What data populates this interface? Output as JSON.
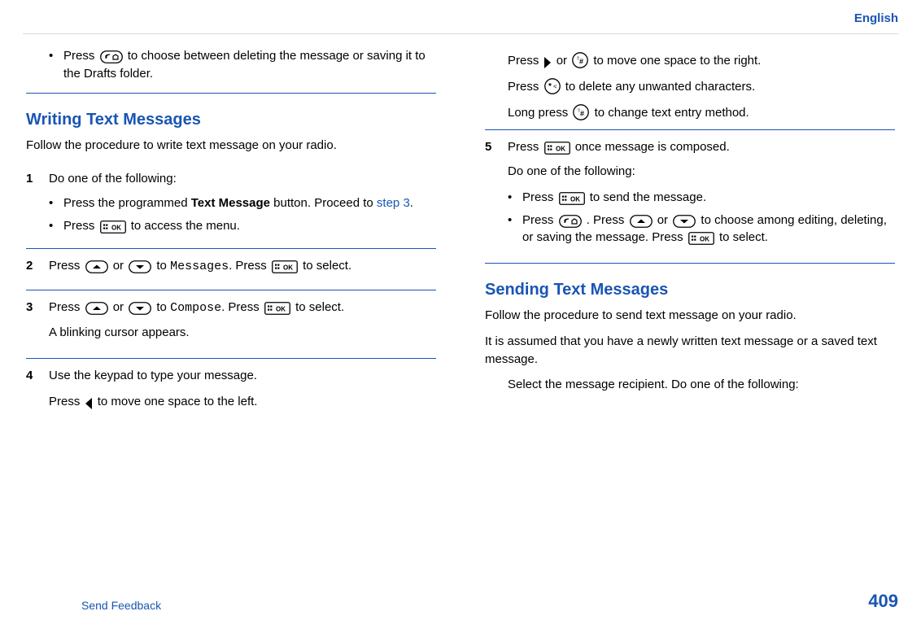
{
  "lang": "English",
  "page_number": "409",
  "feedback": "Send Feedback",
  "col1": {
    "lead_bullet_a": "Press ",
    "lead_bullet_b": " to choose between deleting the message or saving it to the Drafts folder.",
    "h_writing": "Writing Text Messages",
    "writing_intro": "Follow the procedure to write text message on your radio.",
    "s1_text": "Do one of the following:",
    "s1_b1_a": "Press the programmed ",
    "s1_b1_bold": "Text Message",
    "s1_b1_b": " button. Proceed to ",
    "s1_b1_link": "step 3",
    "s1_b1_c": ".",
    "s1_b2_a": "Press ",
    "s1_b2_b": " to access the menu.",
    "s2_a": "Press ",
    "s2_b": " or ",
    "s2_c": " to ",
    "s2_mono": "Messages",
    "s2_d": ". Press ",
    "s2_e": " to select.",
    "s3_a": "Press ",
    "s3_b": " or ",
    "s3_c": " to ",
    "s3_mono": "Compose",
    "s3_d": ". Press ",
    "s3_e": " to select.",
    "s3_f": "A blinking cursor appears.",
    "s4_a": "Use the keypad to type your message.",
    "s4_b1": "Press ",
    "s4_b2": " to move one space to the left."
  },
  "col2": {
    "r1_a": "Press ",
    "r1_b": " or ",
    "r1_c": " to move one space to the right.",
    "r2_a": "Press ",
    "r2_b": " to delete any unwanted characters.",
    "r3_a": "Long press ",
    "r3_b": " to change text entry method.",
    "s5_a": "Press ",
    "s5_b": " once message is composed.",
    "s5_c": "Do one of the following:",
    "s5_b1_a": "Press ",
    "s5_b1_b": " to send the message.",
    "s5_b2_a": "Press ",
    "s5_b2_b": " . Press ",
    "s5_b2_c": " or ",
    "s5_b2_d": " to choose among editing, deleting, or saving the message. Press ",
    "s5_b2_e": " to select.",
    "h_sending": "Sending Text Messages",
    "sending_intro": "Follow the procedure to send text message on your radio.",
    "sending_note": "It is assumed that you have a newly written text message or a saved text message.",
    "sending_step": "Select the message recipient. Do one of the following:"
  }
}
